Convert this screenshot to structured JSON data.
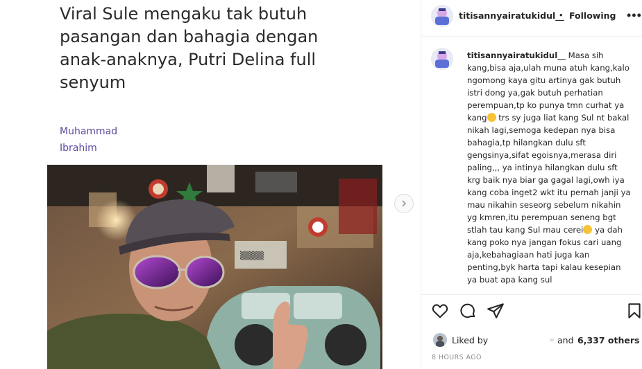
{
  "article": {
    "title": "Viral Sule mengaku tak butuh pasangan dan bahagia dengan anak-anaknya, Putri Delina full senyum",
    "author_line1": "Muhammad",
    "author_line2": "Ibrahim"
  },
  "carousel": {
    "next_label": "›"
  },
  "post": {
    "header": {
      "username": "titisannyairatukidul__",
      "separator": "•",
      "follow_status": "Following",
      "more_label": "•••"
    },
    "comment": {
      "username": "titisannyairatukidul__",
      "text_part1": "Masa sih kang,bisa aja,ulah muna atuh kang,kalo ngomong kaya gitu artinya gak butuh istri dong ya,gak butuh perhatian perempuan,tp ko punya tmn curhat ya kang",
      "text_part2": " trs sy juga liat kang Sul nt bakal nikah lagi,semoga kedepan nya bisa bahagia,tp hilangkan dulu sft gengsinya,sifat egoisnya,merasa diri paling,,, ya intinya hilangkan dulu sft krg baik nya biar ga gagal lagi,owh iya kang coba inget2 wkt itu pernah janji ya mau nikahin seseorg sebelum nikahin yg kmren,itu perempuan seneng bgt stlah tau kang Sul mau cerei",
      "text_part3": " ya dah kang poko nya jangan fokus cari uang aja,kebahagiaan hati juga kan penting,byk harta tapi kalau kesepian ya buat apa kang sul"
    },
    "likes": {
      "liked_by": "Liked by",
      "and": "and",
      "others": "6,337 others"
    },
    "timestamp": "8 HOURS AGO"
  },
  "icons": [
    "heart-icon",
    "comment-icon",
    "share-icon",
    "bookmark-icon",
    "chevron-right-icon",
    "more-options-icon"
  ]
}
